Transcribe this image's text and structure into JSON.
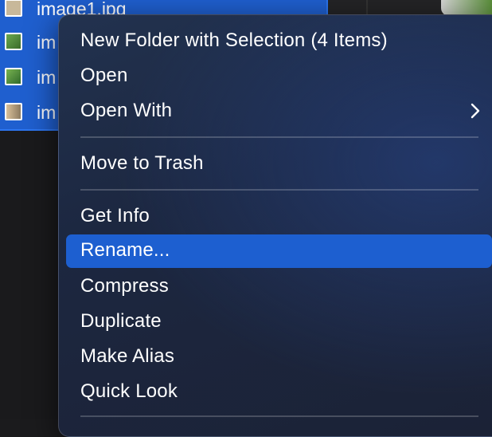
{
  "files": [
    {
      "name": "image1.jpg"
    },
    {
      "name": "im"
    },
    {
      "name": "im"
    },
    {
      "name": "im"
    }
  ],
  "menu": {
    "items": [
      {
        "label": "New Folder with Selection (4 Items)"
      },
      {
        "label": "Open"
      },
      {
        "label": "Open With"
      },
      {
        "label": "Move to Trash"
      },
      {
        "label": "Get Info"
      },
      {
        "label": "Rename..."
      },
      {
        "label": "Compress"
      },
      {
        "label": "Duplicate"
      },
      {
        "label": "Make Alias"
      },
      {
        "label": "Quick Look"
      }
    ],
    "highlighted_index": 5
  },
  "colors": {
    "selection_blue": "#1f5fcf",
    "menu_highlight": "#1d5fd0",
    "menu_text": "#ffffff"
  },
  "icons": {
    "submenu": "chevron-right-icon"
  }
}
